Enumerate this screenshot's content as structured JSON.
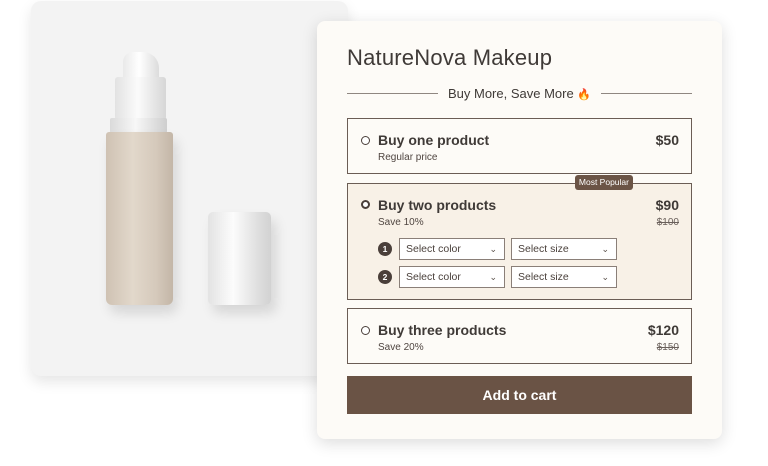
{
  "brand": {
    "title": "NatureNova Makeup"
  },
  "promo": {
    "text": "Buy More, Save More",
    "icon": "fire-icon"
  },
  "options": [
    {
      "title": "Buy one product",
      "subtitle": "Regular price",
      "price": "$50",
      "selected": false
    },
    {
      "title": "Buy two products",
      "subtitle": "Save 10%",
      "price": "$90",
      "old_price": "$100",
      "badge": "Most Popular",
      "selected": true,
      "rows": [
        {
          "number": "1",
          "color_placeholder": "Select color",
          "size_placeholder": "Select size"
        },
        {
          "number": "2",
          "color_placeholder": "Select color",
          "size_placeholder": "Select size"
        }
      ]
    },
    {
      "title": "Buy three products",
      "subtitle": "Save 20%",
      "price": "$120",
      "old_price": "$150",
      "selected": false
    }
  ],
  "cart": {
    "button_label": "Add to cart"
  },
  "colors": {
    "accent": "#6a5345",
    "border": "#6b5d55",
    "selected_bg": "#f8f1e7",
    "card_bg": "#fdfbf7"
  }
}
